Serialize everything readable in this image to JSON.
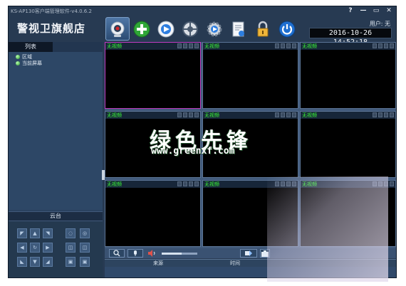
{
  "window": {
    "title": "KS-AP130客户端管理软件-v4.0.6.2",
    "controls": [
      "?",
      "—",
      "▭",
      "✕"
    ]
  },
  "brand": {
    "name": "警视卫旗舰店"
  },
  "toolbar": {
    "buttons": [
      {
        "icon": "camera-icon",
        "active": true
      },
      {
        "icon": "add-device-icon"
      },
      {
        "icon": "playback-icon"
      },
      {
        "icon": "ptz-wheel-icon"
      },
      {
        "icon": "settings-gear-icon"
      },
      {
        "icon": "log-document-icon"
      },
      {
        "icon": "lock-icon"
      },
      {
        "icon": "power-icon"
      }
    ]
  },
  "user": {
    "label": "用户: 无"
  },
  "clock": {
    "value": "2016-10-26 14:52:18"
  },
  "left_panel": {
    "tab_label": "列表",
    "tree": [
      {
        "label": "区域"
      },
      {
        "label": "当前屏幕"
      }
    ],
    "ptz_label": "云台"
  },
  "grid": {
    "rows": 3,
    "cols": 3,
    "cell_label": "无视频",
    "selected_index": 0,
    "cells": [
      "无视频",
      "无视频",
      "无视频",
      "无视频",
      "无视频",
      "无视频",
      "无视频",
      "无视频",
      "无视频"
    ]
  },
  "controls": {
    "buttons": [
      "zoom-icon",
      "mic-icon",
      "volume-icon",
      "switch-icon",
      "snapshot-icon"
    ],
    "volume_level": 0.55
  },
  "log_table": {
    "columns": [
      "来源",
      "时间"
    ]
  },
  "watermark": {
    "title": "绿色先锋",
    "url": "www.greenxf.com"
  },
  "colors": {
    "app_bg": "#273a52",
    "cell_bg": "#000000",
    "cell_label": "#3bff36",
    "selected_border": "#c13cc0"
  }
}
